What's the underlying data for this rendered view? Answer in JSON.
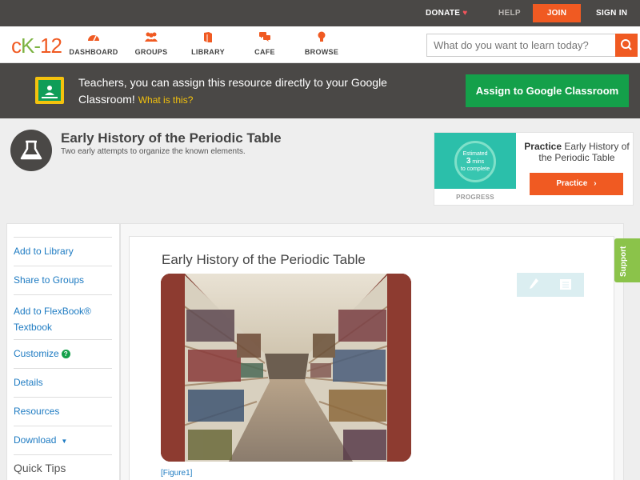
{
  "topbar": {
    "donate": "DONATE",
    "help": "HELP",
    "join": "JOIN",
    "signin": "SIGN IN"
  },
  "nav": {
    "logo": {
      "c": "c",
      "k": "K",
      "dash": "-",
      "n": "12"
    },
    "items": [
      {
        "label": "DASHBOARD",
        "icon": "dashboard-icon"
      },
      {
        "label": "GROUPS",
        "icon": "groups-icon"
      },
      {
        "label": "LIBRARY",
        "icon": "library-icon"
      },
      {
        "label": "CAFE",
        "icon": "cafe-icon"
      },
      {
        "label": "BROWSE",
        "icon": "lightbulb-icon"
      }
    ],
    "search_placeholder": "What do you want to learn today?"
  },
  "classroom": {
    "text": "Teachers, you can assign this resource directly to your Google Classroom!",
    "what": "What is this?",
    "assign": "Assign to Google Classroom"
  },
  "header": {
    "title": "Early History of the Periodic Table",
    "subtitle": "Two early attempts to organize the known elements."
  },
  "practice": {
    "estimated": "Estimated",
    "mins_value": "3",
    "mins_unit": "mins",
    "to_complete": "to complete",
    "progress": "PROGRESS",
    "title_bold": "Practice",
    "title_rest": "Early History of the Periodic Table",
    "button": "Practice"
  },
  "sidebar": {
    "items": [
      {
        "label": "Add to Library"
      },
      {
        "label": "Share to Groups"
      },
      {
        "label": "Add to FlexBook® Textbook"
      },
      {
        "label": "Customize"
      },
      {
        "label": "Details"
      },
      {
        "label": "Resources"
      },
      {
        "label": "Download"
      }
    ],
    "quick_tips": "Quick Tips"
  },
  "content": {
    "title": "Early History of the Periodic Table",
    "figure_caption": "[Figure1]"
  },
  "support": "Support",
  "colors": {
    "brand_orange": "#f05a22",
    "brand_green": "#14a04a",
    "dark_bar": "#4a4846",
    "link_blue": "#1e7bc2"
  }
}
